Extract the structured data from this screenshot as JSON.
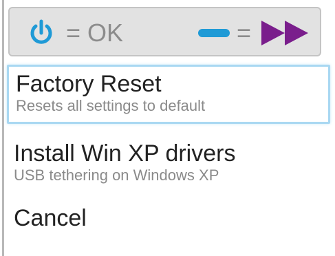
{
  "header": {
    "power_icon": "power-icon",
    "ok_label": "= OK",
    "minus_icon": "minus-icon",
    "next_label": "=",
    "forward_icon": "fast-forward-icon",
    "colors": {
      "power": "#1f9ad6",
      "minus": "#1f9ad6",
      "forward": "#7a1e8c",
      "label": "#8c8c8c"
    }
  },
  "menu": {
    "items": [
      {
        "title": "Factory Reset",
        "subtitle": "Resets all settings to default",
        "selected": true
      },
      {
        "title": "Install Win XP drivers",
        "subtitle": "USB tethering on Windows XP",
        "selected": false
      },
      {
        "title": "Cancel",
        "subtitle": "",
        "selected": false
      }
    ],
    "selection_color": "#a9d8f2"
  }
}
